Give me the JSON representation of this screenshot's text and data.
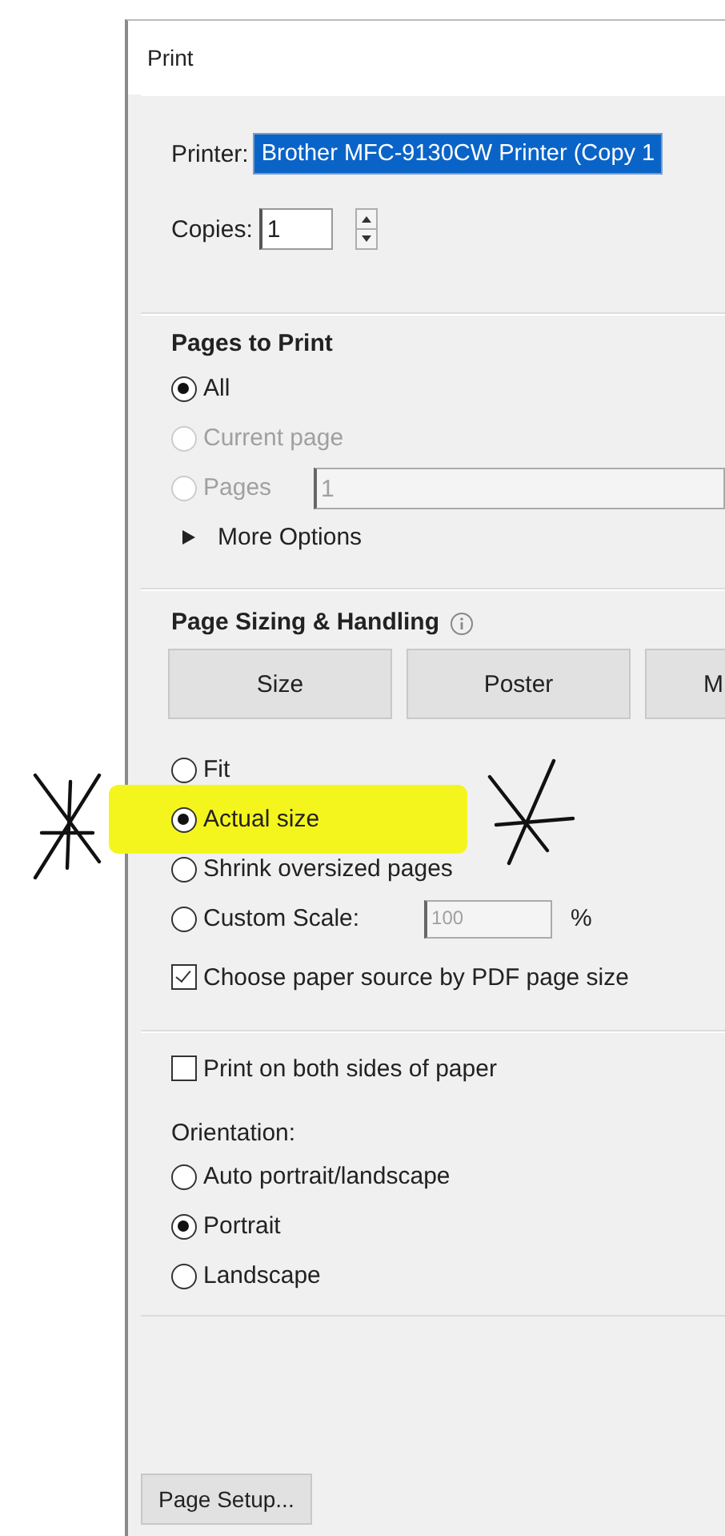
{
  "window": {
    "title": "Print"
  },
  "printer": {
    "label": "Printer:",
    "value": "Brother MFC-9130CW Printer (Copy 1"
  },
  "copies": {
    "label": "Copies:",
    "value": "1"
  },
  "pages_to_print": {
    "title": "Pages to Print",
    "options": [
      {
        "label": "All",
        "selected": true,
        "disabled": false
      },
      {
        "label": "Current page",
        "selected": false,
        "disabled": true
      },
      {
        "label": "Pages",
        "selected": false,
        "disabled": true,
        "value": "1"
      }
    ],
    "more_options": {
      "label": "More Options",
      "expanded": false
    }
  },
  "page_sizing": {
    "title": "Page Sizing & Handling",
    "mode_buttons": [
      "Size",
      "Poster",
      "M"
    ],
    "options": [
      {
        "label": "Fit",
        "selected": false,
        "highlighted": false
      },
      {
        "label": "Actual size",
        "selected": true,
        "highlighted": true
      },
      {
        "label": "Shrink oversized pages",
        "selected": false,
        "highlighted": false
      },
      {
        "label": "Custom Scale:",
        "selected": false,
        "highlighted": false,
        "value": "100",
        "unit": "%"
      }
    ],
    "checkbox": {
      "label": "Choose paper source by PDF page size",
      "checked": true
    }
  },
  "duplex": {
    "label": "Print on both sides of paper",
    "checked": false
  },
  "orientation": {
    "label": "Orientation:",
    "options": [
      {
        "label": "Auto portrait/landscape",
        "selected": false
      },
      {
        "label": "Portrait",
        "selected": true
      },
      {
        "label": "Landscape",
        "selected": false
      }
    ]
  },
  "page_setup_button": "Page Setup..."
}
